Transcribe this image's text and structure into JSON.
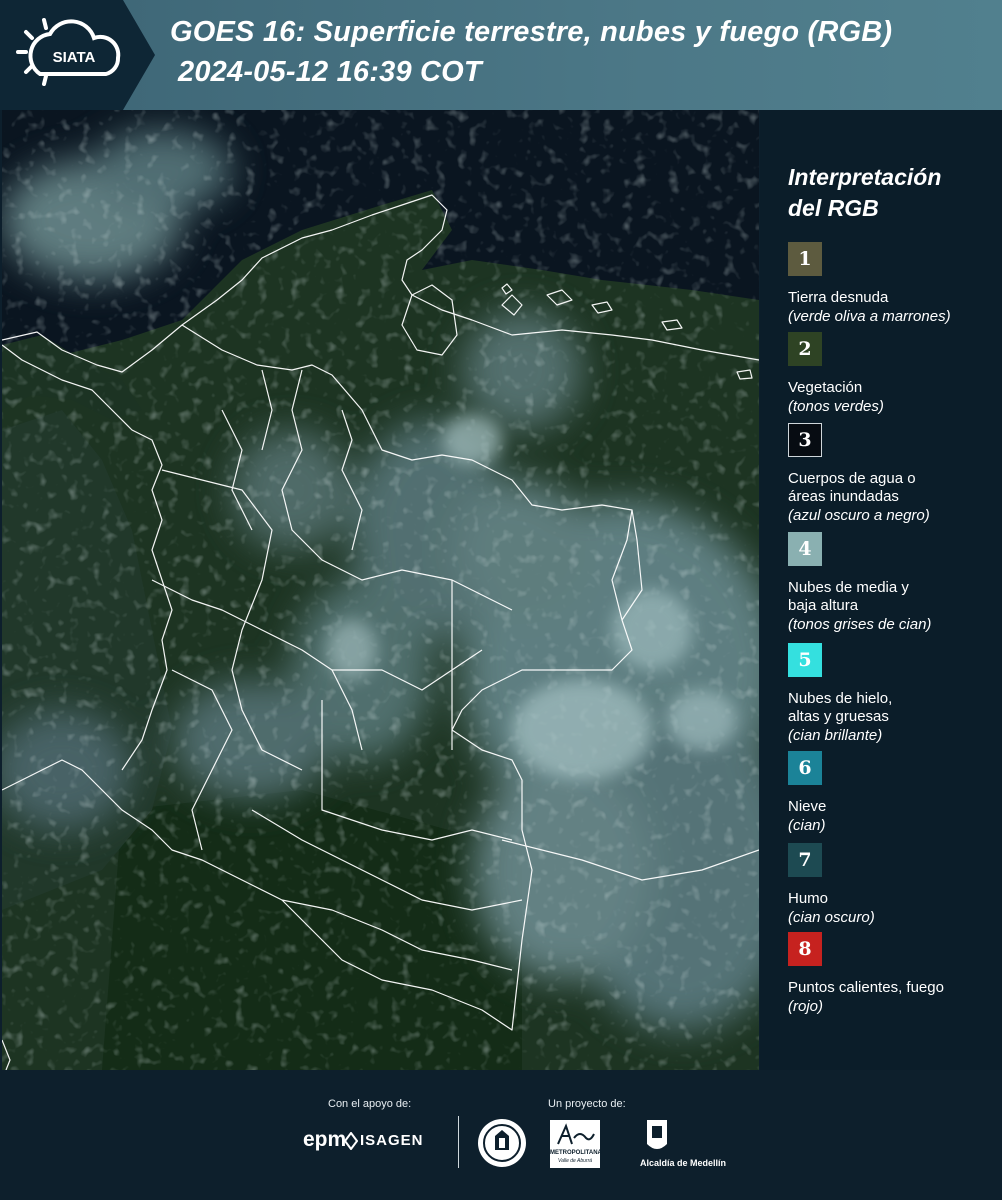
{
  "header": {
    "title_line1": "GOES 16: Superficie terrestre, nubes y fuego (RGB)",
    "title_line2": "2024-05-12 16:39 COT",
    "logo_text": "SIATA"
  },
  "legend": {
    "title_line1": "Interpretación",
    "title_line2": "del RGB",
    "items": [
      {
        "num": "1",
        "color": "#5d5b3f",
        "label_lines": [
          "Tierra desnuda"
        ],
        "hint": "(verde oliva a marrones)"
      },
      {
        "num": "2",
        "color": "#2e4324",
        "label_lines": [
          "Vegetación"
        ],
        "hint": "(tonos verdes)"
      },
      {
        "num": "3",
        "color": "#070c12",
        "label_lines": [
          "Cuerpos de agua o",
          "áreas inundadas"
        ],
        "hint": "(azul oscuro a negro)"
      },
      {
        "num": "4",
        "color": "#8ab0b1",
        "label_lines": [
          "Nubes de media y",
          "baja altura"
        ],
        "hint": "(tonos grises de cian)"
      },
      {
        "num": "5",
        "color": "#34e0df",
        "label_lines": [
          "Nubes de hielo,",
          "altas y gruesas"
        ],
        "hint": "(cian brillante)"
      },
      {
        "num": "6",
        "color": "#1b8398",
        "label_lines": [
          "Nieve"
        ],
        "hint": "(cian)"
      },
      {
        "num": "7",
        "color": "#1d4a52",
        "label_lines": [
          "Humo"
        ],
        "hint": "(cian oscuro)"
      },
      {
        "num": "8",
        "color": "#c6221f",
        "label_lines": [
          "Puntos calientes, fuego"
        ],
        "hint": "(rojo)"
      }
    ]
  },
  "footer": {
    "support_caption": "Con el apoyo de:",
    "project_caption": "Un proyecto de:",
    "sponsor1": "epm",
    "sponsor2": "ISAGEN",
    "partner3_name_line1": "METROPOLITANA",
    "partner3_name_line2": "Valle de Aburrá",
    "partner4": "Alcaldía de Medellín"
  },
  "colors": {
    "header_band": "#4c7887",
    "legend_bg": "#0b1d29",
    "map_ocean": "#0a1520",
    "map_land": "#1f3a25",
    "clouds": "#9fbcbc"
  }
}
